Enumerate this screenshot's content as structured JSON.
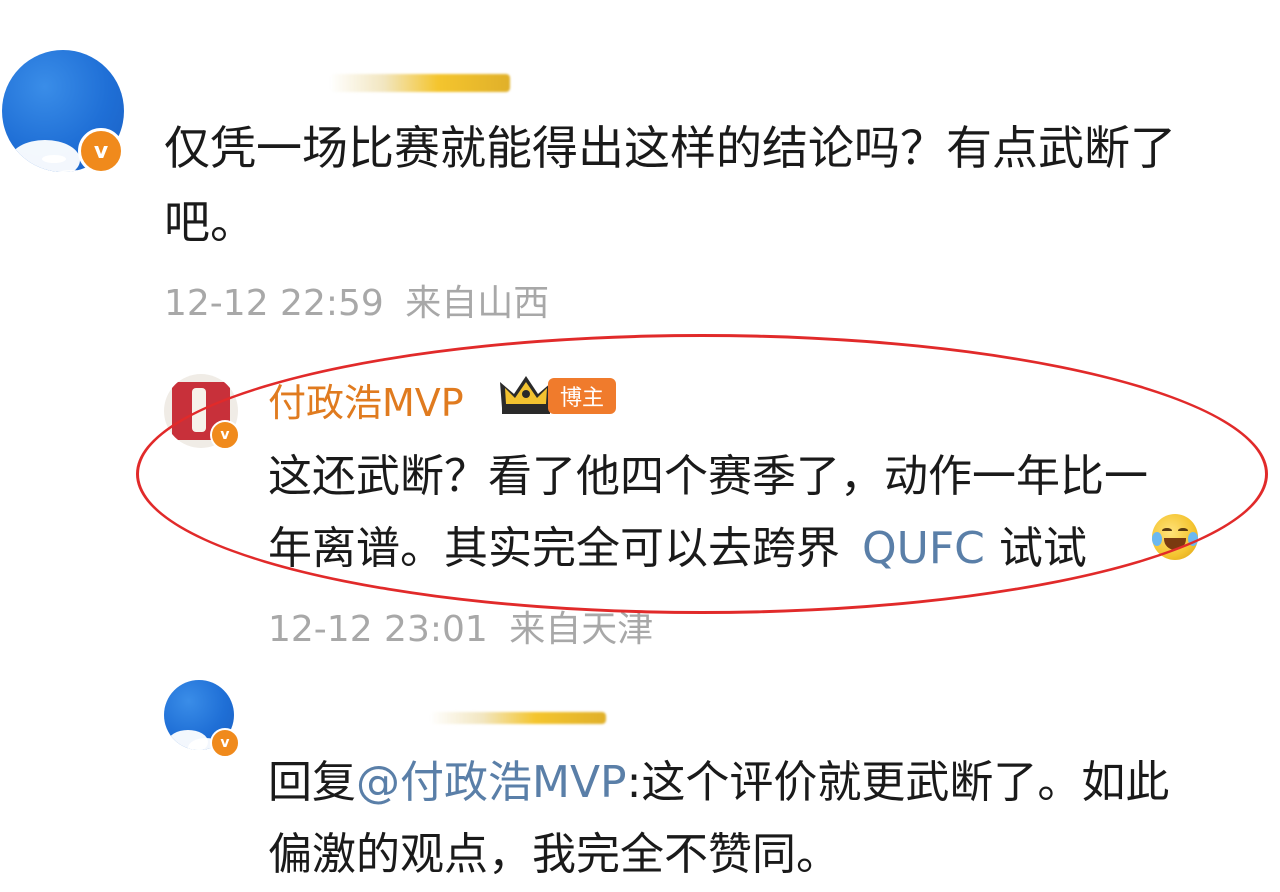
{
  "comment": {
    "text_line1": "仅凭一场比赛就能得出这样的结论吗？有点武断了",
    "text_line2": "吧。",
    "date": "12-12 22:59",
    "location": "来自山西"
  },
  "reply1": {
    "username": "付政浩MVP",
    "badge_label": "博主",
    "text_line1": "这还武断？看了他四个赛季了，动作一年比一",
    "text_line2_a": "年离谱。其实完全可以去跨界",
    "search_icon": "Q",
    "link_text": "UFC",
    "text_line2_b": " 试试",
    "emoji": "laughing-crying-emoji",
    "date": "12-12 23:01",
    "location": "来自天津"
  },
  "reply2": {
    "prefix": "回复",
    "mention": "@付政浩MVP",
    "text_line1_rest": ":这个评价就更武断了。如此",
    "text_line2": "偏激的观点，我完全不赞同。"
  },
  "colors": {
    "username": "#e07b1f",
    "meta": "#a8a8a8",
    "link": "#5a7fa8",
    "verified_badge": "#f08a1c",
    "highlight_ellipse": "#e12a2a"
  }
}
